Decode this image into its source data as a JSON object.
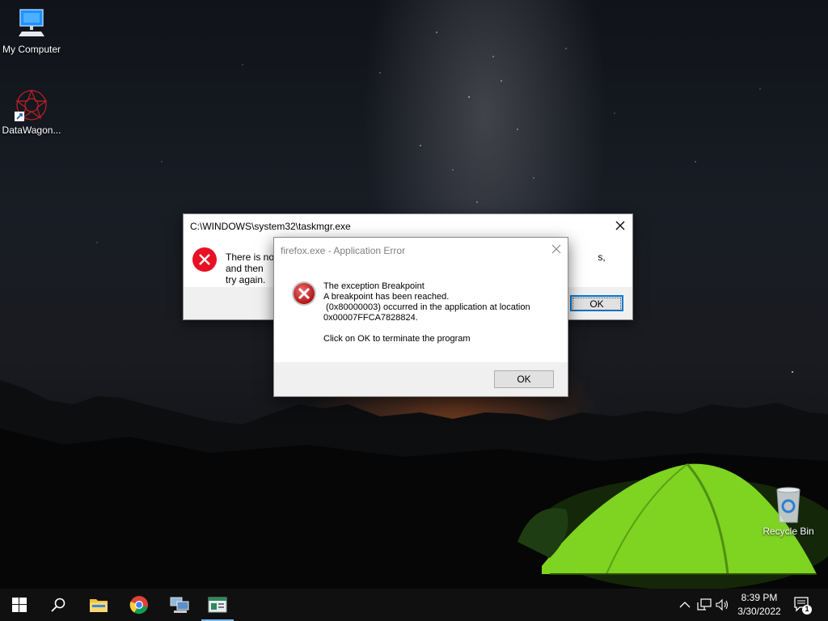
{
  "desktop": {
    "icons": [
      {
        "name": "my-computer",
        "label": "My Computer",
        "icon": "monitor-icon"
      },
      {
        "name": "datawagon",
        "label": "DataWagon...",
        "icon": "datawagon-shortcut-icon"
      },
      {
        "name": "recycle-bin",
        "label": "Recycle Bin",
        "icon": "recycle-bin-icon"
      }
    ]
  },
  "taskmgr_dialog": {
    "title": "C:\\WINDOWS\\system32\\taskmgr.exe",
    "message_left": "There is not",
    "message_right": "s, and then",
    "message_line2": "try again.",
    "ok_label": "OK",
    "icon": "error-circle-icon"
  },
  "firefox_dialog": {
    "title": "firefox.exe - Application Error",
    "lines": [
      "The exception Breakpoint",
      "A breakpoint has been reached.",
      " (0x80000003) occurred in the application at location",
      "0x00007FFCA7828824."
    ],
    "footer_line": "Click on OK to terminate the program",
    "ok_label": "OK",
    "icon": "error-x-icon"
  },
  "taskbar": {
    "pinned": [
      {
        "name": "start-button",
        "icon": "windows-logo-icon"
      },
      {
        "name": "search-button",
        "icon": "search-icon"
      },
      {
        "name": "file-explorer-button",
        "icon": "folder-icon"
      },
      {
        "name": "chrome-button",
        "icon": "chrome-icon"
      },
      {
        "name": "network-app-button",
        "icon": "computer-network-icon"
      },
      {
        "name": "app-window-button",
        "icon": "app-window-icon",
        "active": true
      }
    ],
    "tray": [
      "chevron-up-icon",
      "network-icon",
      "volume-icon"
    ],
    "time": "8:39 PM",
    "date": "3/30/2022",
    "notification_count": "1"
  },
  "colors": {
    "accent": "#0078d7",
    "error_red": "#e81123",
    "taskbar": "#101010"
  }
}
